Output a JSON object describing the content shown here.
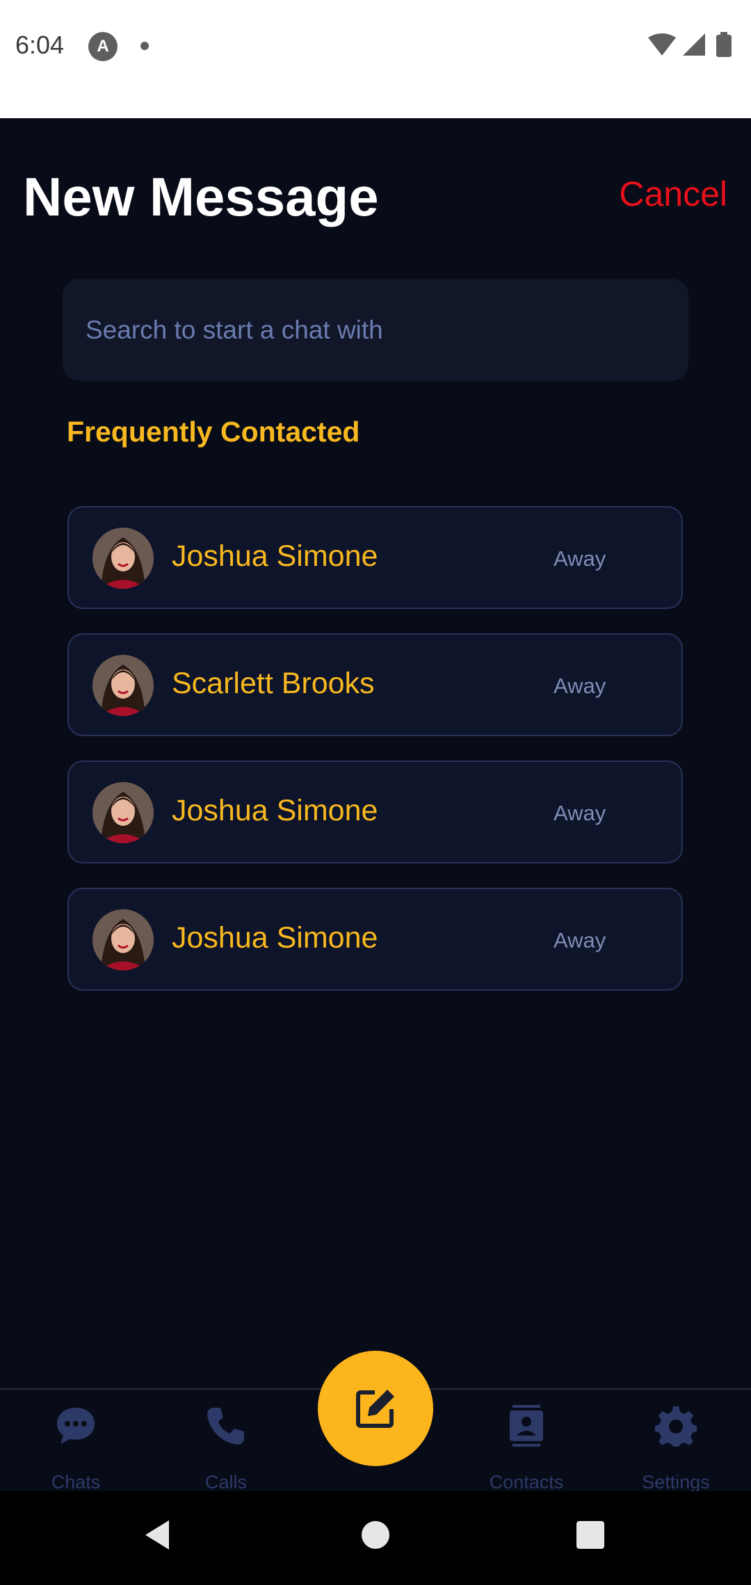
{
  "status_bar": {
    "time": "6:04",
    "app_icon": "A"
  },
  "header": {
    "title": "New Message",
    "cancel_label": "Cancel"
  },
  "search": {
    "placeholder": "Search to start a chat with"
  },
  "frequent": {
    "title": "Frequently Contacted",
    "contacts": [
      {
        "name": "Joshua Simone",
        "status": "Away"
      },
      {
        "name": "Scarlett Brooks",
        "status": "Away"
      },
      {
        "name": "Joshua Simone",
        "status": "Away"
      },
      {
        "name": "Joshua Simone",
        "status": "Away"
      }
    ]
  },
  "bottom_nav": {
    "items": [
      {
        "label": "Chats",
        "icon": "chat-bubble-icon"
      },
      {
        "label": "Calls",
        "icon": "phone-icon"
      },
      {
        "label": "Contacts",
        "icon": "contacts-icon"
      },
      {
        "label": "Settings",
        "icon": "gear-icon"
      }
    ],
    "fab_icon": "compose-icon"
  },
  "colors": {
    "background": "#080b18",
    "accent": "#f8b81f",
    "cancel": "#e8101a",
    "muted": "#7f8cb5"
  }
}
